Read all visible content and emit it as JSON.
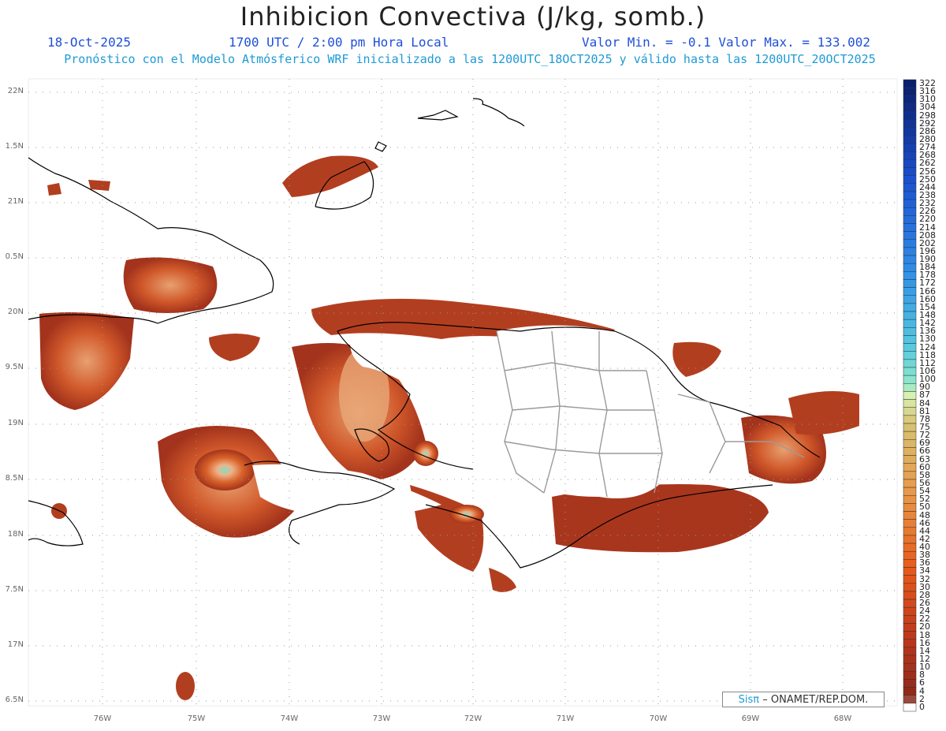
{
  "header": {
    "title": "Inhibicion Convectiva (J/kg, somb.)",
    "date": "18-Oct-2025",
    "time": "1700 UTC / 2:00 pm Hora Local",
    "minmax": "Valor Min. = -0.1  Valor Max. = 133.002",
    "description": "Pronóstico con el Modelo Atmósferico WRF inicializado a las 1200UTC_18OCT2025 y válido hasta las  1200UTC_20OCT2025"
  },
  "axes": {
    "lat_labels": [
      "22N",
      "1.5N",
      "21N",
      "0.5N",
      "20N",
      "9.5N",
      "19N",
      "8.5N",
      "18N",
      "7.5N",
      "17N",
      "6.5N"
    ],
    "lon_labels": [
      "76W",
      "75W",
      "74W",
      "73W",
      "72W",
      "71W",
      "70W",
      "69W",
      "68W"
    ]
  },
  "colorbar": {
    "labels": [
      "322",
      "316",
      "310",
      "304",
      "298",
      "292",
      "286",
      "280",
      "274",
      "268",
      "262",
      "256",
      "250",
      "244",
      "238",
      "232",
      "226",
      "220",
      "214",
      "208",
      "202",
      "196",
      "190",
      "184",
      "178",
      "172",
      "166",
      "160",
      "154",
      "148",
      "142",
      "136",
      "130",
      "124",
      "118",
      "112",
      "106",
      "100",
      "90",
      "87",
      "84",
      "81",
      "78",
      "75",
      "72",
      "69",
      "66",
      "63",
      "60",
      "58",
      "56",
      "54",
      "52",
      "50",
      "48",
      "46",
      "44",
      "42",
      "40",
      "38",
      "36",
      "34",
      "32",
      "30",
      "28",
      "26",
      "24",
      "22",
      "20",
      "18",
      "16",
      "14",
      "12",
      "10",
      "8",
      "6",
      "4",
      "2",
      "0"
    ]
  },
  "credit": {
    "sis": "Sisπ",
    "org": "– ONAMET/REP.DOM."
  },
  "colors": {
    "title": "#222222",
    "subtitle": "#1f4fd8",
    "description": "#1e9ad6",
    "field_low": "#a3331c",
    "field_mid": "#d9632a",
    "field_high": "#e8a878",
    "field_peak": "#7de0c8"
  }
}
